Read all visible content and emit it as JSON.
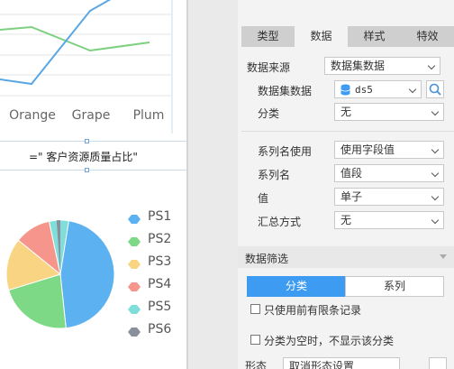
{
  "line_chart": {
    "categories": [
      "Orange",
      "Grape",
      "Plum"
    ],
    "series_colors": [
      "#5aa7e6",
      "#7dd07f"
    ]
  },
  "formula_bar": {
    "text": "=\"  客户资源质量占比\""
  },
  "pie_chart": {
    "legend": [
      {
        "name": "PS1",
        "color": "#5cb1f0"
      },
      {
        "name": "PS2",
        "color": "#7ed987"
      },
      {
        "name": "PS3",
        "color": "#f9d583"
      },
      {
        "name": "PS4",
        "color": "#f5958c"
      },
      {
        "name": "PS5",
        "color": "#7fded9"
      },
      {
        "name": "PS6",
        "color": "#8a8f9e"
      }
    ]
  },
  "panel": {
    "tabs": [
      {
        "label": "类型"
      },
      {
        "label": "数据"
      },
      {
        "label": "样式"
      },
      {
        "label": "特效"
      }
    ],
    "active_tab": "数据",
    "data_source_label": "数据来源",
    "data_source_value": "数据集数据",
    "dataset_label": "数据集数据",
    "dataset_value": "ds5",
    "category_label": "分类",
    "category_value": "无",
    "series_name_use_label": "系列名使用",
    "series_name_use_value": "使用字段值",
    "series_name_label": "系列名",
    "series_name_value": "值段",
    "value_label": "值",
    "value_value": "单子",
    "summary_label": "汇总方式",
    "summary_value": "无",
    "filter_title": "数据筛选",
    "filter_tabs": [
      "分类",
      "系列"
    ],
    "active_filter_tab": "分类",
    "only_use_first_label": "只使用前有限条记录",
    "hide_empty_category_label": "分类为空时，不显示该分类",
    "form_label": "形态",
    "form_value": "取消形态设置"
  },
  "colors": {
    "accent": "#3d9bf2",
    "tab_bar": "#cfcfcf",
    "panel_bg": "#f3f3f3"
  }
}
